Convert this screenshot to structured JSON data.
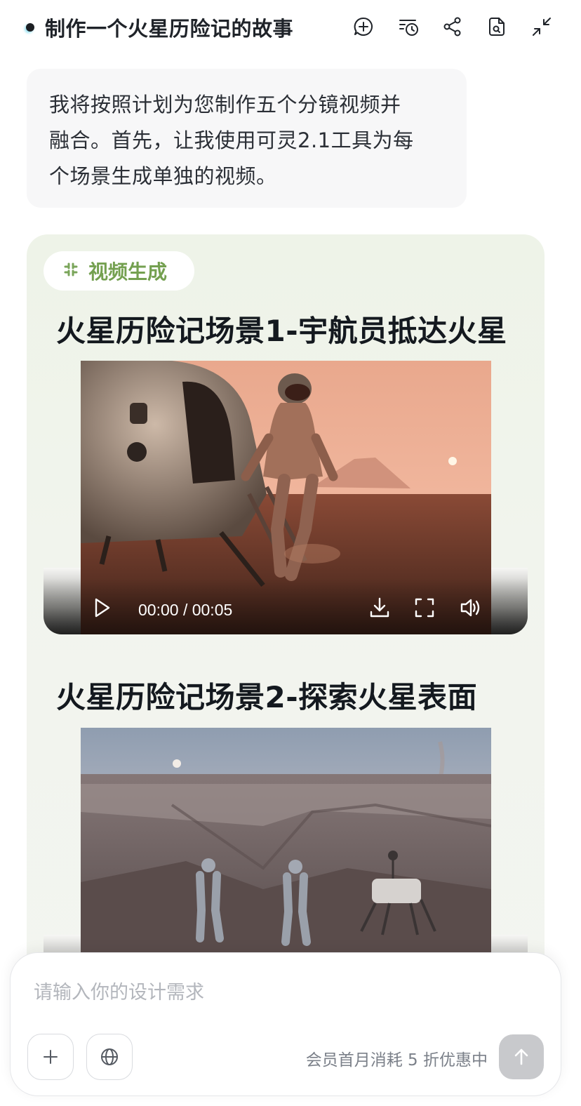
{
  "header": {
    "title": "制作一个火星历险记的故事",
    "icons": [
      "add-chat-icon",
      "history-icon",
      "share-icon",
      "file-search-icon",
      "collapse-icon"
    ]
  },
  "message": {
    "text_lines": [
      "我将按照计划为您制作五个分镜视频并",
      "融合。首先，让我使用可灵2.1工具为每",
      "个场景生成单独的视频。"
    ]
  },
  "tool_card": {
    "tag_label": "视频生成",
    "tag_icon": "video-generate-icon",
    "accent_color": "#74a050",
    "scenes": [
      {
        "title": "火星历险记场景1-宇航员抵达火星",
        "time": "00:00 / 00:05"
      },
      {
        "title": "火星历险记场景2-探索火星表面"
      }
    ]
  },
  "composer": {
    "placeholder": "请输入你的设计需求",
    "promo": "会员首月消耗 5 折优惠中",
    "icons": [
      "plus-icon",
      "globe-icon",
      "send-arrow-icon"
    ]
  }
}
